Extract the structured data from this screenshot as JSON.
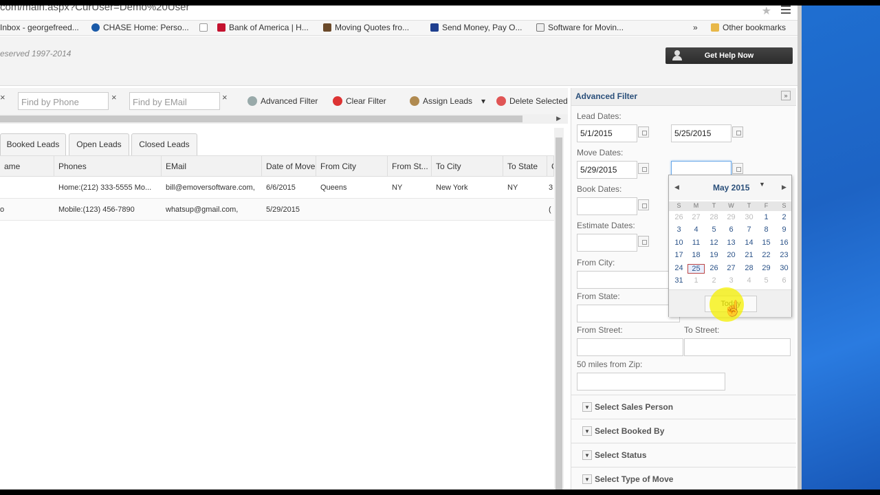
{
  "browser": {
    "url": "com/main.aspx?CurUser=Demo%20User",
    "bookmarks": [
      {
        "label": "Inbox - georgefreed...",
        "color": "#888888"
      },
      {
        "label": "CHASE Home: Perso...",
        "color": "#1a5aa8"
      },
      {
        "label": "",
        "color": "#ffffff"
      },
      {
        "label": "Bank of America | H...",
        "color": "#c4122f"
      },
      {
        "label": "Moving Quotes fro...",
        "color": "#6b4a2a"
      },
      {
        "label": "Send Money, Pay O...",
        "color": "#1f3f8f"
      },
      {
        "label": "Software for Movin...",
        "color": "#555555"
      }
    ],
    "more": "»",
    "other_bookmarks": "Other bookmarks"
  },
  "header": {
    "copyright": "eserved 1997-2014",
    "help_button": "Get Help Now"
  },
  "toolbar": {
    "phone_placeholder": "Find by Phone",
    "email_placeholder": "Find by EMail",
    "clear_x": "×",
    "advanced_filter": "Advanced Filter",
    "clear_filter": "Clear Filter",
    "assign_leads": "Assign Leads",
    "assign_caret": "▾",
    "delete_selected": "Delete Selected"
  },
  "tabs": [
    "Booked Leads",
    "Open Leads",
    "Closed Leads"
  ],
  "grid": {
    "columns": [
      "ame",
      "Phones",
      "EMail",
      "Date of Move",
      "From City",
      "From St...",
      "To City",
      "To State",
      "C"
    ],
    "rows": [
      [
        "",
        "Home:(212) 333-5555 Mo...",
        "bill@emoversoftware.com,",
        "6/6/2015",
        "Queens",
        "NY",
        "New York",
        "NY",
        "3"
      ],
      [
        "o",
        "Mobile:(123) 456-7890",
        "whatsup@gmail.com,",
        "5/29/2015",
        "",
        "",
        "",
        "",
        "("
      ]
    ]
  },
  "filter": {
    "title": "Advanced Filter",
    "collapse": "»",
    "lead_dates": "Lead Dates:",
    "lead_from": "5/1/2015",
    "lead_to": "5/25/2015",
    "move_dates": "Move Dates:",
    "move_from": "5/29/2015",
    "move_to": "",
    "book_dates": "Book Dates:",
    "estimate_dates": "Estimate Dates:",
    "from_city": "From City:",
    "from_state": "From State:",
    "from_street": "From Street:",
    "to_street": "To Street:",
    "zip": "50 miles from Zip:",
    "sections": [
      "Select Sales Person",
      "Select Booked By",
      "Select Status",
      "Select Type of Move"
    ]
  },
  "datepicker": {
    "month": "May 2015",
    "prev": "◀",
    "next": "▶",
    "drop": "▼",
    "dow": [
      "S",
      "M",
      "T",
      "W",
      "T",
      "F",
      "S"
    ],
    "weeks": [
      [
        "26",
        "27",
        "28",
        "29",
        "30",
        "1",
        "2"
      ],
      [
        "3",
        "4",
        "5",
        "6",
        "7",
        "8",
        "9"
      ],
      [
        "10",
        "11",
        "12",
        "13",
        "14",
        "15",
        "16"
      ],
      [
        "17",
        "18",
        "19",
        "20",
        "21",
        "22",
        "23"
      ],
      [
        "24",
        "25",
        "26",
        "27",
        "28",
        "29",
        "30"
      ],
      [
        "31",
        "1",
        "2",
        "3",
        "4",
        "5",
        "6"
      ]
    ],
    "selected": "25",
    "today": "Today"
  }
}
